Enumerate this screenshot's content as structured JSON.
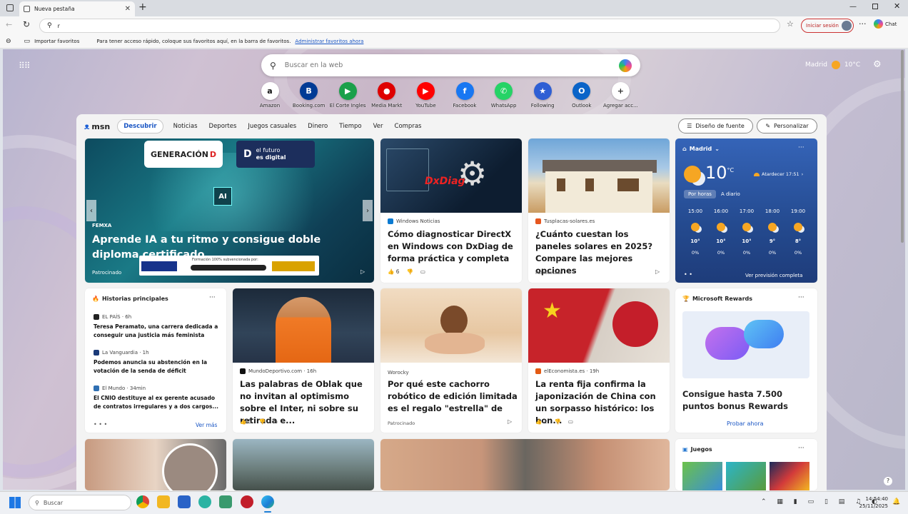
{
  "browser": {
    "tab_title": "Nueva pestaña",
    "new_tab_symbol": "+",
    "address_text": "r",
    "signin_label": "Iniciar sesión",
    "chat_label": "Chat",
    "fav_import": "Importar favoritos",
    "fav_hint": "Para tener acceso rápido, coloque sus favoritos aquí, en la barra de favoritos.",
    "fav_manage": "Administrar favoritos ahora"
  },
  "newtab": {
    "search_placeholder": "Buscar en la web",
    "weather_city": "Madrid",
    "weather_temp": "10°C",
    "tiles": [
      {
        "label": "Amazon",
        "glyph": "a",
        "color": "#ffffff",
        "fg": "#111111"
      },
      {
        "label": "Booking.com",
        "glyph": "B",
        "color": "#003b95",
        "fg": "#ffffff"
      },
      {
        "label": "El Corte Ingles",
        "glyph": "▶",
        "color": "#1aa04a",
        "fg": "#ffffff"
      },
      {
        "label": "Media Markt",
        "glyph": "●",
        "color": "#df0000",
        "fg": "#ffffff"
      },
      {
        "label": "YouTube",
        "glyph": "▶",
        "color": "#ff0000",
        "fg": "#ffffff"
      },
      {
        "label": "Facebook",
        "glyph": "f",
        "color": "#1877f2",
        "fg": "#ffffff"
      },
      {
        "label": "WhatsApp",
        "glyph": "✆",
        "color": "#25d366",
        "fg": "#ffffff"
      },
      {
        "label": "Following",
        "glyph": "★",
        "color": "#2e5fd4",
        "fg": "#ffffff"
      },
      {
        "label": "Outlook",
        "glyph": "O",
        "color": "#0a64c8",
        "fg": "#ffffff"
      },
      {
        "label": "Agregar acc...",
        "glyph": "+",
        "color": "#ffffff",
        "fg": "#333333"
      }
    ]
  },
  "msn": {
    "logo": "msn",
    "nav": [
      "Descubrir",
      "Noticias",
      "Deportes",
      "Juegos casuales",
      "Dinero",
      "Tiempo",
      "Ver",
      "Compras"
    ],
    "font_btn": "Diseño de fuente",
    "personalize_btn": "Personalizar"
  },
  "hero": {
    "brand1": "GENERACIÓN",
    "brand2_line1": "el futuro",
    "brand2_line2": "es digital",
    "ai_badge": "AI",
    "tag": "FEMXA",
    "title": "Aprende IA a tu ritmo y consigue doble diploma certificado",
    "sponsored": "Patrocinado",
    "subsidy": "Formación 100% subvencionada por:"
  },
  "card_dx": {
    "img_text": "DxDiag",
    "source": "Windows Noticias",
    "title": "Cómo diagnosticar DirectX en Windows con DxDiag de forma práctica y completa",
    "likes": "6"
  },
  "card_solar": {
    "source": "Tusplacas-solares.es",
    "title": "¿Cuánto cuestan los paneles solares en 2025? Compare las mejores opciones",
    "sponsored": "Patrocinado"
  },
  "weather": {
    "city": "Madrid",
    "temp": "10",
    "unit": "°C",
    "sunset": "Atardecer 17:51",
    "tab_hourly": "Por horas",
    "tab_daily": "A diario",
    "hours": [
      {
        "time": "15:00",
        "temp": "10°",
        "rain": "0%"
      },
      {
        "time": "16:00",
        "temp": "10°",
        "rain": "0%"
      },
      {
        "time": "17:00",
        "temp": "10°",
        "rain": "0%"
      },
      {
        "time": "18:00",
        "temp": "9°",
        "rain": "0%"
      },
      {
        "time": "19:00",
        "temp": "8°",
        "rain": "0%"
      }
    ],
    "full_forecast": "Ver previsión completa"
  },
  "top_stories": {
    "header": "Historias principales",
    "items": [
      {
        "source": "EL PAÍS · 6h",
        "title": "Teresa Peramato, una carrera dedicada a conseguir una justicia más feminista"
      },
      {
        "source": "La Vanguardia · 1h",
        "title": "Podemos anuncia su abstención en la votación de la senda de déficit"
      },
      {
        "source": "El Mundo · 34min",
        "title": "El CNIO destituye al ex gerente acusado de contratos irregulares y a dos cargos..."
      }
    ],
    "see_more": "Ver más"
  },
  "card_oblak": {
    "source": "MundoDeportivo.com · 16h",
    "title": "Las palabras de Oblak que no invitan al optimismo sobre el Inter, ni sobre su retirada e...",
    "likes": "5"
  },
  "card_puppy": {
    "source": "Worocky",
    "title": "Por qué este cachorro robótico de edición limitada es el regalo \"estrella\" de",
    "sponsored": "Patrocinado"
  },
  "card_china": {
    "source": "elEconomista.es · 19h",
    "title": "La renta fija confirma la japonización de China con un sorpasso histórico: los bon...",
    "likes": "1"
  },
  "rewards": {
    "header": "Microsoft Rewards",
    "title": "Consigue hasta 7.500 puntos bonus Rewards",
    "cta": "Probar ahora"
  },
  "games": {
    "header": "Juegos"
  },
  "taskbar": {
    "search": "Buscar",
    "time": "14:54:40",
    "date": "25/11/2025"
  }
}
